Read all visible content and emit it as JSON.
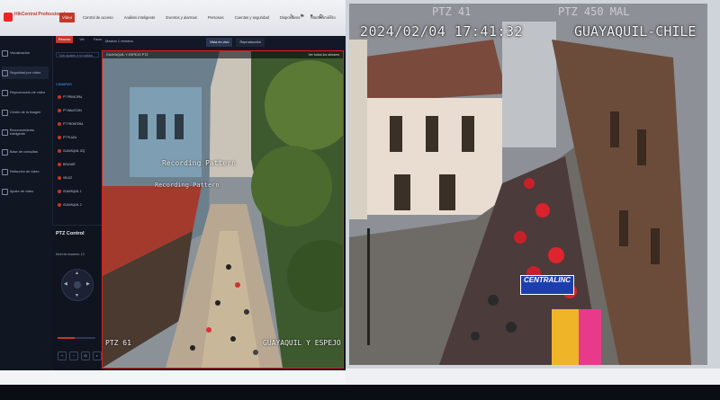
{
  "app": {
    "title": "HikCentral Professional",
    "nav_tabs": [
      "Vídeo",
      "Control de acceso",
      "Análisis inteligente",
      "Eventos y alarmas",
      "Personas",
      "Cuentas y seguridad",
      "Dispositivos",
      "Mantenimiento"
    ]
  },
  "sidebar": {
    "items": [
      "Visualización",
      "Seguridad por vídeo",
      "Reproducción de vídeo",
      "Centro de la imagen",
      "Reconocimiento inteligente",
      "Base de consultas",
      "Refacción de vídeo",
      "Ajuste de vídeo"
    ]
  },
  "resources": {
    "tabs": [
      "Recurso",
      "Ver",
      "Favorito"
    ],
    "search_placeholder": "Todo ajustes a no validos",
    "group_label": "CAMARAS",
    "cameras": [
      "PT PRINCIPAL",
      "PT MALECON",
      "PT FRONTERA",
      "PT PLAZA",
      "GUAYAQUIL IZQ",
      "BOLIVAR",
      "VELEZ",
      "GUAYAQUIL 1",
      "GUAYAQUIL 2"
    ],
    "folder_label": "AREA CENTRAL"
  },
  "ptz": {
    "title": "PTZ Control",
    "speed_label": "Nivel de escaneo: 13",
    "level": 0.45
  },
  "view_toolbar": {
    "view_name": "Mostrar 1 ventana",
    "tabs": [
      "Vista en vivo",
      "Reproducción"
    ]
  },
  "left_tile": {
    "header_left": "GUAYAQUIL Y ESPEJO PTZ",
    "header_right": "Ver todos los streams",
    "overlay_recording": "Recording Pattern",
    "overlay_label": "Recording Pattern",
    "bottom_left": "PTZ 61",
    "bottom_right": "GUAYAQUIL Y ESPEJO"
  },
  "right_cam": {
    "top_faint_left": "PTZ 41",
    "top_faint_right": "PTZ 450 MAL",
    "timestamp": "2024/02/04 17:41:32",
    "location": "GUAYAQUIL-CHILE",
    "banner_text": "CENTRALINC"
  }
}
